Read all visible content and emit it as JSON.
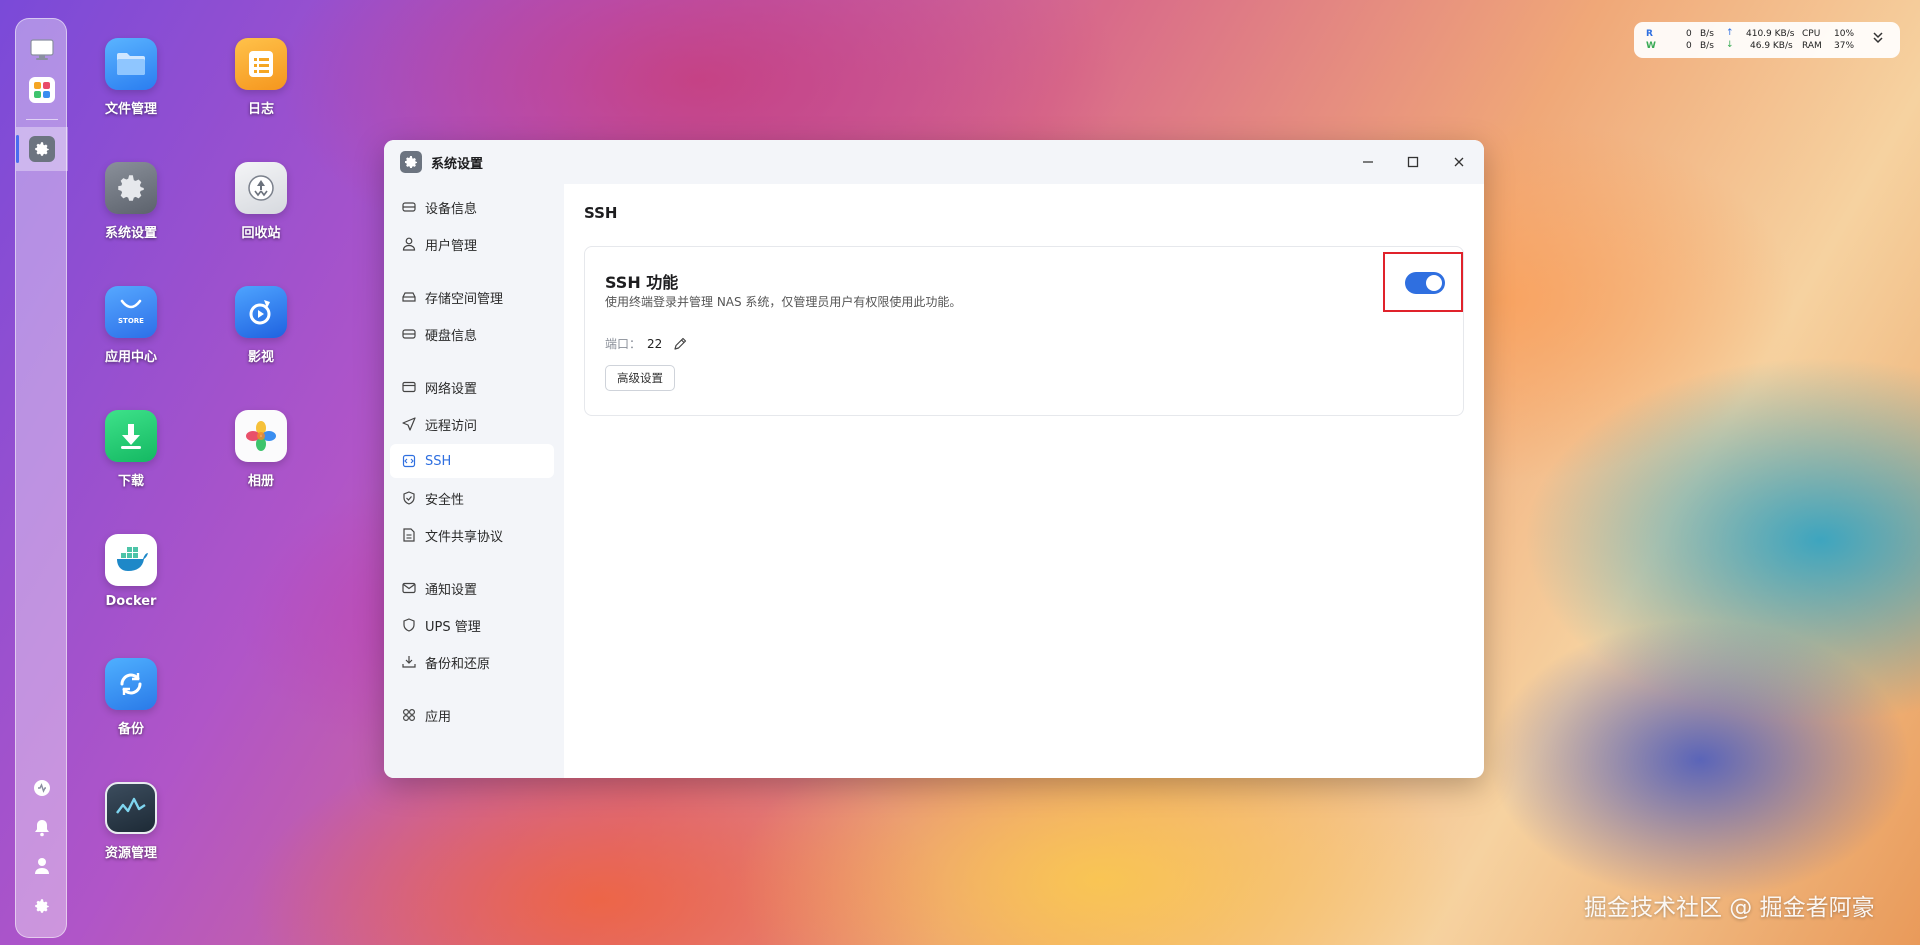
{
  "desktop": {
    "apps": [
      {
        "label": "文件管理",
        "icon": "folder-icon"
      },
      {
        "label": "日志",
        "icon": "log-icon"
      },
      {
        "label": "系统设置",
        "icon": "settings-icon"
      },
      {
        "label": "回收站",
        "icon": "recycle-bin-icon"
      },
      {
        "label": "应用中心",
        "icon": "store-icon"
      },
      {
        "label": "影视",
        "icon": "video-icon"
      },
      {
        "label": "下载",
        "icon": "download-icon"
      },
      {
        "label": "相册",
        "icon": "photos-icon"
      },
      {
        "label": "Docker",
        "icon": "docker-icon"
      },
      {
        "label": "备份",
        "icon": "backup-icon"
      },
      {
        "label": "资源管理",
        "icon": "resource-monitor-icon"
      }
    ],
    "store_badge": "STORE"
  },
  "status": {
    "read_label": "R",
    "write_label": "W",
    "read_value": "0",
    "read_unit": "B/s",
    "write_value": "0",
    "write_unit": "B/s",
    "upload_value": "410.9 KB/s",
    "download_value": "46.9 KB/s",
    "cpu_label": "CPU",
    "cpu_value": "10%",
    "ram_label": "RAM",
    "ram_value": "37%"
  },
  "window": {
    "title": "系统设置",
    "nav": [
      {
        "label": "设备信息",
        "icon": "device-icon"
      },
      {
        "label": "用户管理",
        "icon": "user-icon"
      },
      {
        "label": "存储空间管理",
        "icon": "storage-icon"
      },
      {
        "label": "硬盘信息",
        "icon": "disk-icon"
      },
      {
        "label": "网络设置",
        "icon": "network-icon"
      },
      {
        "label": "远程访问",
        "icon": "remote-icon"
      },
      {
        "label": "SSH",
        "icon": "ssh-icon",
        "active": true
      },
      {
        "label": "安全性",
        "icon": "shield-icon"
      },
      {
        "label": "文件共享协议",
        "icon": "file-share-icon"
      },
      {
        "label": "通知设置",
        "icon": "mail-icon"
      },
      {
        "label": "UPS 管理",
        "icon": "ups-icon"
      },
      {
        "label": "备份和还原",
        "icon": "backup-restore-icon"
      },
      {
        "label": "应用",
        "icon": "apps-icon"
      }
    ],
    "page_title": "SSH",
    "card": {
      "title": "SSH 功能",
      "description": "使用终端登录并管理 NAS 系统，仅管理员用户有权限使用此功能。",
      "port_label": "端口：",
      "port_value": "22",
      "advanced_button": "高级设置",
      "ssh_enabled": true
    }
  },
  "watermark": "掘金技术社区 @ 掘金者阿豪",
  "colors": {
    "accent": "#2f6fe0",
    "highlight_box": "#e0222b"
  }
}
